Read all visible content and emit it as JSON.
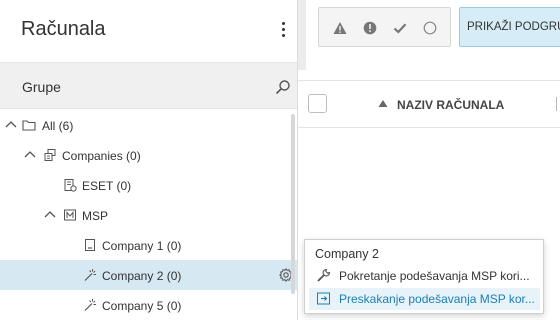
{
  "panel": {
    "title": "Računala",
    "groups_label": "Grupe"
  },
  "tree": {
    "items": [
      {
        "label": "All (6)",
        "icon": "folder-icon",
        "expanded": true
      },
      {
        "label": "Companies (0)",
        "icon": "companies-icon",
        "expanded": true
      },
      {
        "label": "ESET (0)",
        "icon": "eset-group-icon"
      },
      {
        "label": "MSP",
        "icon": "msp-icon",
        "expanded": true
      },
      {
        "label": "Company 1 (0)",
        "icon": "company-building-icon"
      },
      {
        "label": "Company 2 (0)",
        "icon": "company-pending-icon",
        "selected": true
      },
      {
        "label": "Company 5 (0)",
        "icon": "company-pending-icon"
      }
    ]
  },
  "filters": {
    "status_icons": [
      "warning-triangle-icon",
      "error-circle-icon",
      "ok-check-icon",
      "empty-circle-icon"
    ],
    "subgroups_label": "PRIKAŽI PODGRUPE"
  },
  "table": {
    "columns": [
      {
        "label": "NAZIV RAČUNALA",
        "sort": "asc"
      }
    ]
  },
  "context_menu": {
    "title": "Company 2",
    "items": [
      {
        "label": "Pokretanje podešavanja MSP kori...",
        "icon": "wrench-icon"
      },
      {
        "label": "Preskakanje podešavanja MSP kor...",
        "icon": "skip-setup-icon",
        "highlighted": true
      }
    ]
  },
  "colors": {
    "selection": "#d6e8f2",
    "accent": "#1a7fb5",
    "button_bg": "#d6edf8"
  }
}
